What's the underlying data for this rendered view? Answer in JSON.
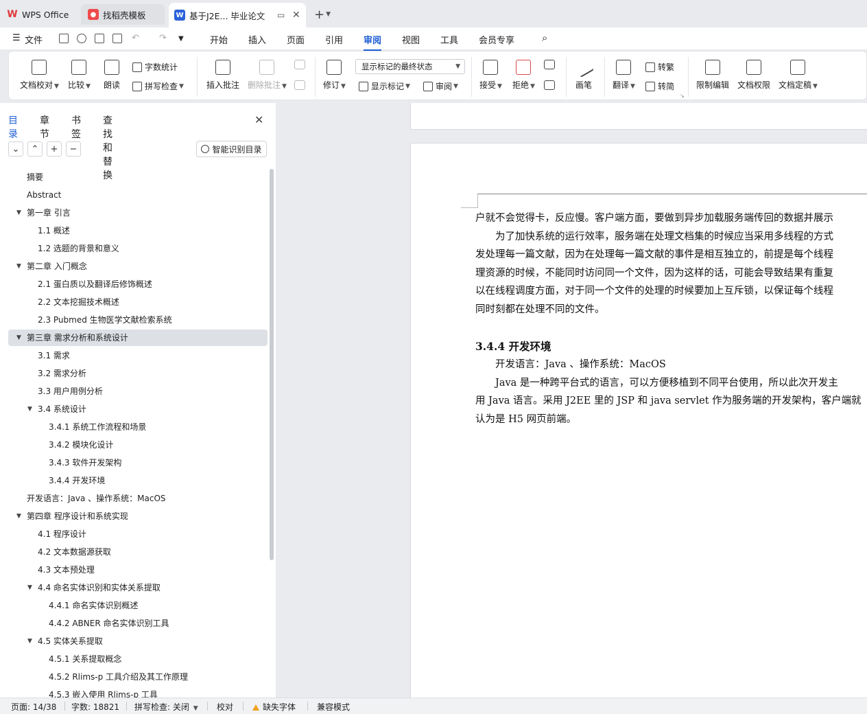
{
  "tabs": {
    "wps": "WPS Office",
    "template": "找稻壳模板",
    "document": "基于J2E... 毕业论文",
    "new_tab_symbol": "+"
  },
  "menu": {
    "file": "文件",
    "items": [
      "开始",
      "插入",
      "页面",
      "引用",
      "审阅",
      "视图",
      "工具",
      "会员专享"
    ],
    "active": "审阅"
  },
  "ribbon": {
    "doc_check": "文档校对",
    "compare": "比较",
    "read_aloud": "朗读",
    "word_count": "字数统计",
    "spell_check": "拼写检查",
    "insert_comment": "插入批注",
    "delete_comment": "删除批注",
    "revise": "修订",
    "markup_select": "显示标记的最终状态",
    "show_markup": "显示标记",
    "review": "审阅",
    "accept": "接受",
    "reject": "拒绝",
    "ink": "画笔",
    "translate": "翻译",
    "to_traditional": "转繁",
    "to_simplified": "转简",
    "restrict_edit": "限制编辑",
    "doc_permission": "文档权限",
    "finalize": "文档定稿"
  },
  "nav": {
    "tabs": [
      "目录",
      "章节",
      "书签",
      "查找和替换"
    ],
    "active_tab": "目录",
    "smart_button": "智能识别目录",
    "toc": [
      {
        "label": "摘要",
        "level": 1,
        "arrow": ""
      },
      {
        "label": "Abstract",
        "level": 1,
        "arrow": ""
      },
      {
        "label": "第一章  引言",
        "level": 1,
        "arrow": "▼"
      },
      {
        "label": "1.1  概述",
        "level": 2,
        "arrow": ""
      },
      {
        "label": "1.2  选题的背景和意义",
        "level": 2,
        "arrow": ""
      },
      {
        "label": "第二章  入门概念",
        "level": 1,
        "arrow": "▼"
      },
      {
        "label": "2.1  蛋白质以及翻译后修饰概述",
        "level": 2,
        "arrow": ""
      },
      {
        "label": "2.2 文本挖掘技术概述",
        "level": 2,
        "arrow": ""
      },
      {
        "label": "2.3 Pubmed 生物医学文献检索系统",
        "level": 2,
        "arrow": ""
      },
      {
        "label": "第三章  需求分析和系统设计",
        "level": 1,
        "arrow": "▼",
        "selected": true
      },
      {
        "label": "3.1 需求",
        "level": 2,
        "arrow": ""
      },
      {
        "label": "3.2  需求分析",
        "level": 2,
        "arrow": ""
      },
      {
        "label": "3.3  用户用例分析",
        "level": 2,
        "arrow": ""
      },
      {
        "label": "3.4  系统设计",
        "level": 2,
        "arrow": "▼"
      },
      {
        "label": "3.4.1  系统工作流程和场景",
        "level": 3,
        "arrow": ""
      },
      {
        "label": "3.4.2  模块化设计",
        "level": 3,
        "arrow": ""
      },
      {
        "label": "3.4.3  软件开发架构",
        "level": 3,
        "arrow": ""
      },
      {
        "label": "3.4.4  开发环境",
        "level": 3,
        "arrow": ""
      },
      {
        "label": "开发语言：Java  、操作系统：MacOS",
        "level": 1,
        "arrow": ""
      },
      {
        "label": "第四章  程序设计和系统实现",
        "level": 1,
        "arrow": "▼"
      },
      {
        "label": "4.1  程序设计",
        "level": 2,
        "arrow": ""
      },
      {
        "label": "4.2  文本数据源获取",
        "level": 2,
        "arrow": ""
      },
      {
        "label": "4.3  文本预处理",
        "level": 2,
        "arrow": ""
      },
      {
        "label": "4.4  命名实体识别和实体关系提取",
        "level": 2,
        "arrow": "▼"
      },
      {
        "label": "4.4.1 命名实体识别概述",
        "level": 3,
        "arrow": ""
      },
      {
        "label": "4.4.2 ABNER 命名实体识别工具",
        "level": 3,
        "arrow": ""
      },
      {
        "label": "4.5  实体关系提取",
        "level": 2,
        "arrow": "▼"
      },
      {
        "label": "4.5.1  关系提取概念",
        "level": 3,
        "arrow": ""
      },
      {
        "label": "4.5.2 Rlims-p 工具介绍及其工作原理",
        "level": 3,
        "arrow": ""
      },
      {
        "label": "4.5.3  嵌入使用 Rlims-p 工具",
        "level": 3,
        "arrow": ""
      }
    ]
  },
  "document": {
    "lines": [
      "户就不会觉得卡，反应慢。客户端方面，要做到异步加载服务端传回的数据并展示",
      "　　为了加快系统的运行效率，服务端在处理文档集的时候应当采用多线程的方式",
      "发处理每一篇文献，因为在处理每一篇文献的事件是相互独立的，前提是每个线程",
      "理资源的时候，不能同时访问同一个文件，因为这样的话，可能会导致结果有重复",
      "以在线程调度方面，对于同一个文件的处理的时候要加上互斥锁，以保证每个线程",
      "同时刻都在处理不同的文件。"
    ],
    "heading": "3.4.4  开发环境",
    "lines2": [
      "　　开发语言：Java  、操作系统：MacOS",
      "　　Java 是一种跨平台式的语言，可以方便移植到不同平台使用，所以此次开发主",
      "用 Java 语言。采用 J2EE 里的 JSP 和 java servlet 作为服务端的开发架构，客户端就",
      "认为是 H5 网页前端。"
    ]
  },
  "status": {
    "page": "页面: 14/38",
    "words": "字数: 18821",
    "spell": "拼写检查: 关闭",
    "proof": "校对",
    "missing_font": "缺失字体",
    "compat": "兼容模式"
  },
  "colors": {
    "accent": "#1f5fd6",
    "selected_row": "#dde0e5",
    "warning": "#f0a11c"
  }
}
